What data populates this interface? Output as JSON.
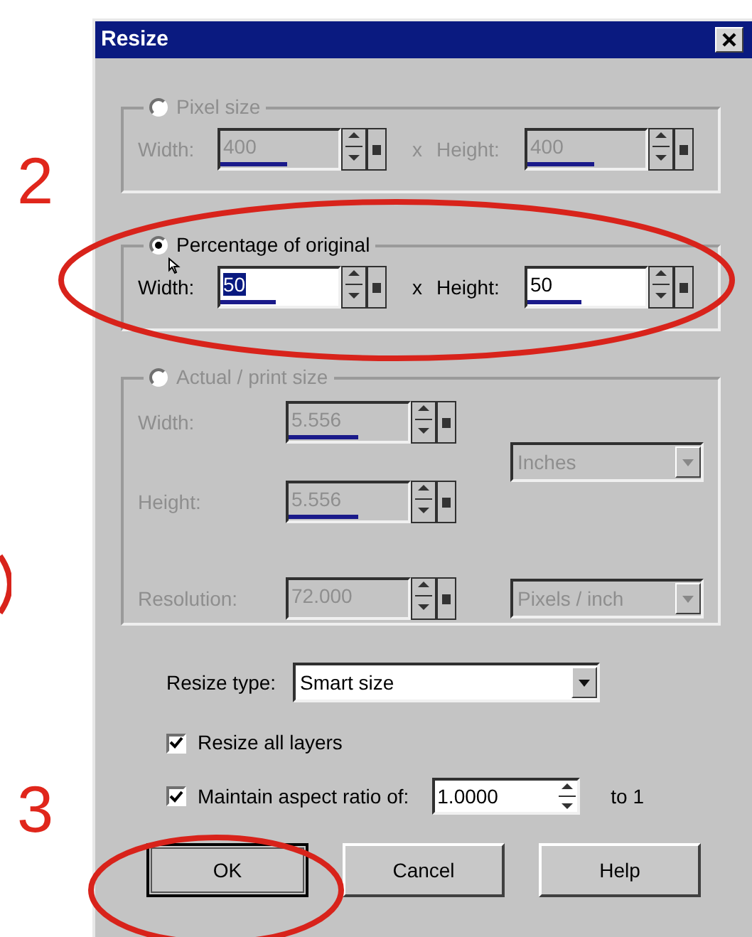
{
  "window": {
    "title": "Resize"
  },
  "annotations": [
    {
      "text": "2"
    },
    {
      "text": "3"
    }
  ],
  "pixel_size": {
    "label": "Pixel size",
    "selected": false,
    "disabled": true,
    "separator": "x",
    "width": {
      "label": "Width:",
      "value": "400",
      "level": 0.57,
      "text_selected": false
    },
    "height": {
      "label": "Height:",
      "value": "400",
      "level": 0.57,
      "text_selected": false
    }
  },
  "percentage": {
    "label": "Percentage of original",
    "selected": true,
    "disabled": false,
    "separator": "x",
    "width": {
      "label": "Width:",
      "value": "50",
      "level": 0.47,
      "text_selected": true
    },
    "height": {
      "label": "Height:",
      "value": "50",
      "level": 0.46,
      "text_selected": false
    }
  },
  "actual_size": {
    "label": "Actual / print size",
    "selected": false,
    "disabled": true,
    "width": {
      "label": "Width:",
      "value": "5.556",
      "level": 0.58,
      "text_selected": false
    },
    "height": {
      "label": "Height:",
      "value": "5.556",
      "level": 0.58,
      "text_selected": false
    },
    "units": "Inches",
    "resolution": {
      "label": "Resolution:",
      "value": "72.000",
      "text_selected": false
    },
    "resolution_units": "Pixels / inch"
  },
  "resize_type": {
    "label": "Resize type:",
    "value": "Smart size"
  },
  "resize_all_layers": {
    "label": "Resize all layers",
    "checked": true
  },
  "maintain_aspect_ratio": {
    "label": "Maintain aspect ratio of:",
    "checked": true,
    "value": "1.0000",
    "suffix": "to 1"
  },
  "buttons": [
    {
      "label": "OK",
      "default": true
    },
    {
      "label": "Cancel",
      "default": false
    },
    {
      "label": "Help",
      "default": false
    }
  ]
}
